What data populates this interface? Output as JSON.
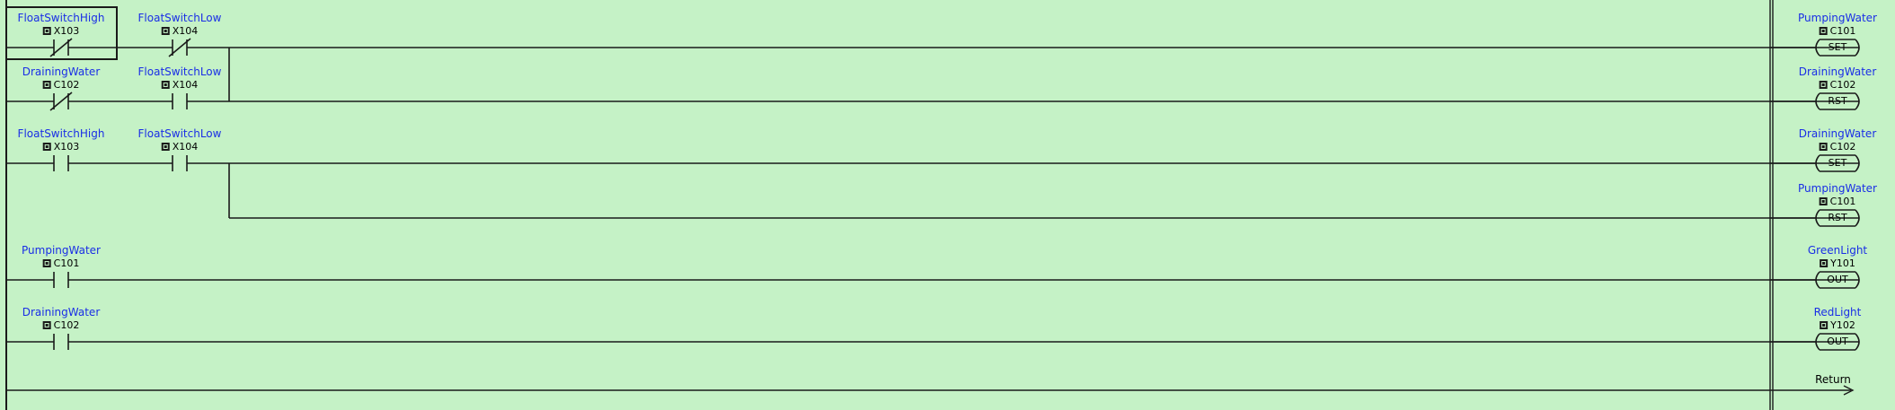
{
  "rungs": [
    {
      "contacts": [
        {
          "label": "FloatSwitchHigh",
          "address": "X103",
          "type": "nc"
        },
        {
          "label": "FloatSwitchLow",
          "address": "X104",
          "type": "nc"
        }
      ],
      "coil": {
        "label": "PumpingWater",
        "address": "C101",
        "cmd": "SET"
      }
    },
    {
      "contacts": [
        {
          "label": "DrainingWater",
          "address": "C102",
          "type": "nc"
        },
        {
          "label": "FloatSwitchLow",
          "address": "X104",
          "type": "no"
        }
      ],
      "coil": {
        "label": "DrainingWater",
        "address": "C102",
        "cmd": "RST"
      }
    },
    {
      "contacts": [
        {
          "label": "FloatSwitchHigh",
          "address": "X103",
          "type": "no"
        },
        {
          "label": "FloatSwitchLow",
          "address": "X104",
          "type": "no"
        }
      ],
      "coil": {
        "label": "DrainingWater",
        "address": "C102",
        "cmd": "SET"
      }
    },
    {
      "contacts": [],
      "coil": {
        "label": "PumpingWater",
        "address": "C101",
        "cmd": "RST"
      }
    },
    {
      "contacts": [
        {
          "label": "PumpingWater",
          "address": "C101",
          "type": "no"
        }
      ],
      "coil": {
        "label": "GreenLight",
        "address": "Y101",
        "cmd": "OUT"
      }
    },
    {
      "contacts": [
        {
          "label": "DrainingWater",
          "address": "C102",
          "type": "no"
        }
      ],
      "coil": {
        "label": "RedLight",
        "address": "Y102",
        "cmd": "OUT"
      }
    }
  ],
  "return_label": "Return",
  "colors": {
    "background": "#c5f2c6",
    "label": "#1a2ee6",
    "wire": "#1a1a1a"
  }
}
